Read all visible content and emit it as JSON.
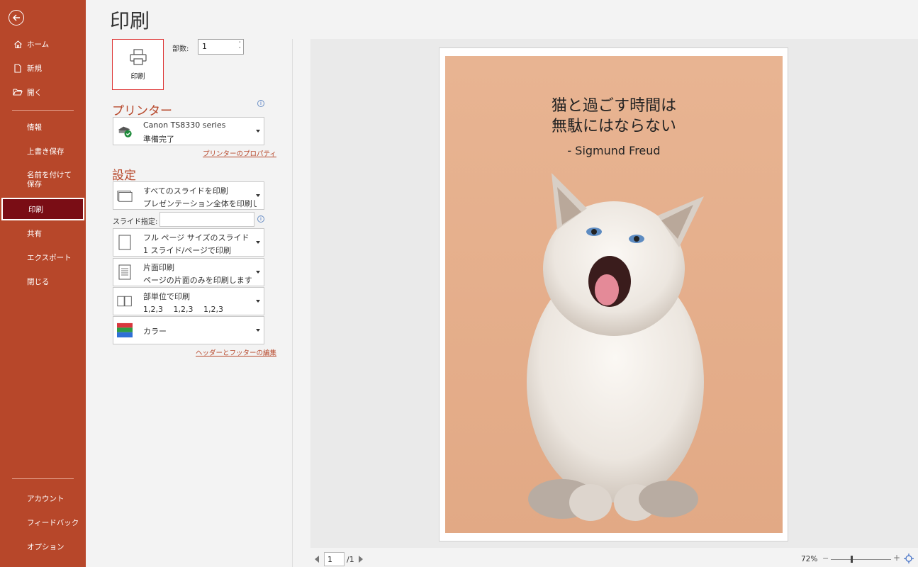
{
  "sidebar": {
    "items": [
      {
        "label": "ホーム",
        "icon": "home-icon"
      },
      {
        "label": "新規",
        "icon": "new-document-icon"
      },
      {
        "label": "開く",
        "icon": "open-folder-icon"
      },
      {
        "label": "情報"
      },
      {
        "label": "上書き保存"
      },
      {
        "label": "名前を付けて保存"
      },
      {
        "label": "印刷",
        "active": true
      },
      {
        "label": "共有"
      },
      {
        "label": "エクスポート"
      },
      {
        "label": "閉じる"
      }
    ],
    "bottom_items": [
      {
        "label": "アカウント"
      },
      {
        "label": "フィードバック"
      },
      {
        "label": "オプション"
      }
    ],
    "accent_color": "#b7472a",
    "active_color": "#7a0d15"
  },
  "main": {
    "title": "印刷",
    "print_button_label": "印刷",
    "copies_label": "部数:",
    "copies_value": "1",
    "printer_section_title": "プリンター",
    "printer_name": "Canon TS8330 series",
    "printer_status": "準備完了",
    "printer_properties_link": "プリンターのプロパティ",
    "settings_section_title": "設定",
    "range": {
      "line1": "すべてのスライドを印刷",
      "line2": "プレゼンテーション全体を印刷し…"
    },
    "slides_label": "スライド指定:",
    "slides_value": "",
    "layout": {
      "line1": "フル ページ サイズのスライド",
      "line2": "1 スライド/ページで印刷"
    },
    "sides": {
      "line1": "片面印刷",
      "line2": "ページの片面のみを印刷します"
    },
    "collate": {
      "line1": "部単位で印刷",
      "line2": "1,2,3　 1,2,3　 1,2,3"
    },
    "color": {
      "line1": "カラー"
    },
    "header_footer_link": "ヘッダーとフッターの編集"
  },
  "preview": {
    "quote_line1": "猫と過ごす時間は",
    "quote_line2": "無駄にはならない",
    "author": "- Sigmund Freud",
    "slide_bg_color": "#e8b492"
  },
  "pager": {
    "current_page": "1",
    "total": "/1"
  },
  "zoom": {
    "percent": "72%",
    "minus": "−",
    "plus": "+",
    "level": 72
  }
}
